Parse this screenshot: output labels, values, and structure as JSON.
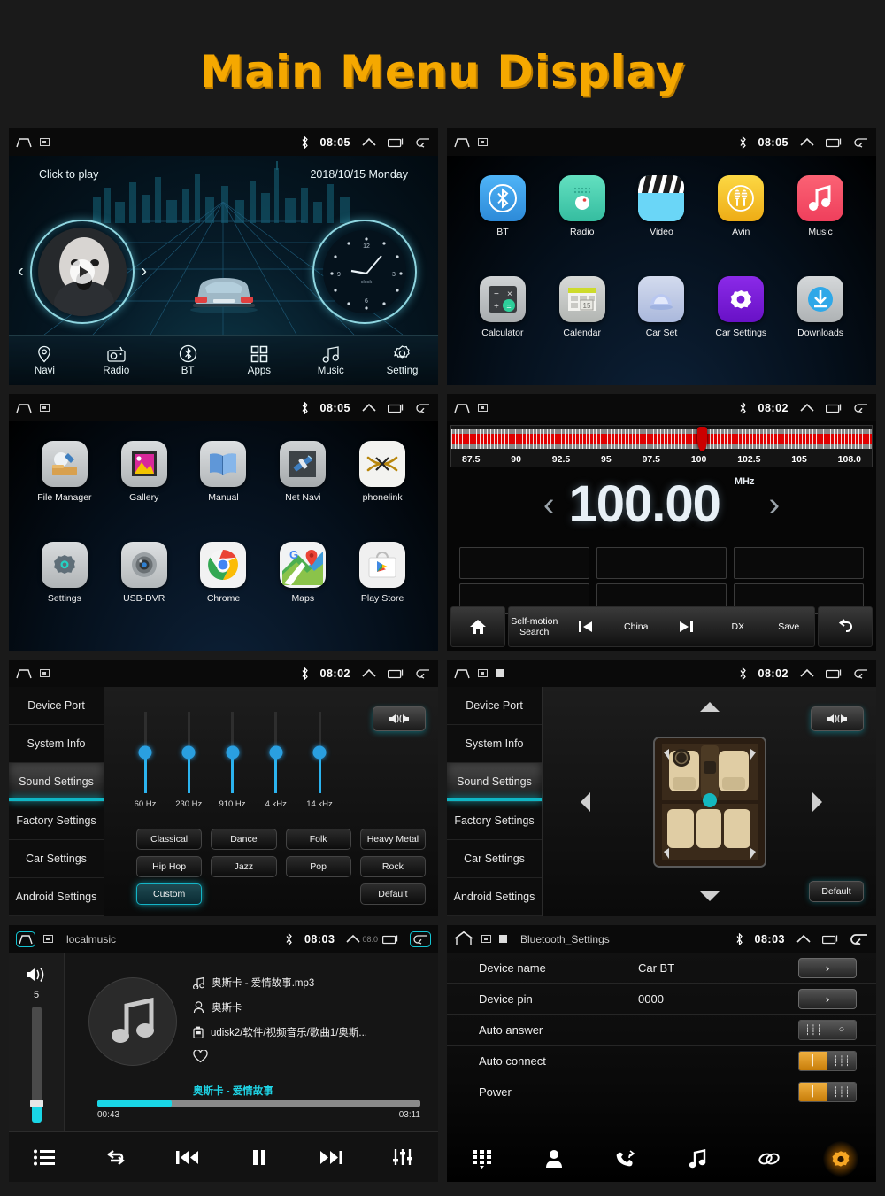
{
  "page": {
    "title": "Main Menu Display",
    "title_color": "#f5a800"
  },
  "panels": {
    "home": {
      "status": {
        "time": "08:05",
        "bt_icon": "bluetooth-icon"
      },
      "click_to_play": "Click to play",
      "date": "2018/10/15  Monday",
      "clock_label": "clock",
      "clock_marks": [
        "12",
        "3",
        "6",
        "9"
      ],
      "dock": [
        {
          "label": "Navi",
          "icon": "location-pin-icon"
        },
        {
          "label": "Radio",
          "icon": "radio-icon"
        },
        {
          "label": "BT",
          "icon": "bluetooth-icon"
        },
        {
          "label": "Apps",
          "icon": "grid-apps-icon"
        },
        {
          "label": "Music",
          "icon": "music-note-icon"
        },
        {
          "label": "Setting",
          "icon": "gear-icon"
        }
      ]
    },
    "apps1": {
      "status": {
        "time": "08:05"
      },
      "items": [
        {
          "label": "BT",
          "icon": "bluetooth-icon",
          "color": "#3fa9f5"
        },
        {
          "label": "Radio",
          "icon": "radio-icon",
          "color": "#4ddbb4"
        },
        {
          "label": "Video",
          "icon": "clapperboard-icon",
          "color": "#5fd0f5"
        },
        {
          "label": "Avin",
          "icon": "avin-icon",
          "color": "#f5c518"
        },
        {
          "label": "Music",
          "icon": "music-note-icon",
          "color": "#f2556b"
        },
        {
          "label": "Calculator",
          "icon": "calculator-icon",
          "color": "#b9bcbe"
        },
        {
          "label": "Calendar",
          "icon": "calendar-icon",
          "color": "#c9cbc9"
        },
        {
          "label": "Car Set",
          "icon": "car-set-icon",
          "color": "#c6cfe0"
        },
        {
          "label": "Car Settings",
          "icon": "car-settings-icon",
          "color": "#7a22d8"
        },
        {
          "label": "Downloads",
          "icon": "download-icon",
          "color": "#c9cbcd"
        }
      ]
    },
    "apps2": {
      "status": {
        "time": "08:05"
      },
      "items": [
        {
          "label": "File Manager",
          "icon": "file-manager-icon",
          "color": "#c9cbcd"
        },
        {
          "label": "Gallery",
          "icon": "gallery-icon",
          "color": "#c9cbcd"
        },
        {
          "label": "Manual",
          "icon": "manual-book-icon",
          "color": "#c9cbcd"
        },
        {
          "label": "Net Navi",
          "icon": "satellite-icon",
          "color": "#b6b9bb"
        },
        {
          "label": "phonelink",
          "icon": "phonelink-icon",
          "color": "#eeeeee"
        },
        {
          "label": "Settings",
          "icon": "gear-icon",
          "color": "#c9cbcd"
        },
        {
          "label": "USB-DVR",
          "icon": "dvr-camera-icon",
          "color": "#c9cbcd"
        },
        {
          "label": "Chrome",
          "icon": "chrome-icon",
          "color": "#f2f2f2"
        },
        {
          "label": "Maps",
          "icon": "maps-icon",
          "color": "#f2f2f2"
        },
        {
          "label": "Play Store",
          "icon": "play-store-icon",
          "color": "#f2f2f2"
        }
      ]
    },
    "radio": {
      "status": {
        "time": "08:02"
      },
      "frequency": "100.00",
      "unit": "MHz",
      "scale_ticks": [
        "87.5",
        "90",
        "92.5",
        "95",
        "97.5",
        "100",
        "102.5",
        "105",
        "108.0"
      ],
      "marker_percent": 59,
      "preset_count": 6,
      "bar": {
        "home": "home-icon",
        "search": "Self-motion\nSearch",
        "prev": "prev-icon",
        "region": "China",
        "next": "next-icon",
        "dx": "DX",
        "save": "Save",
        "back": "back-icon"
      }
    },
    "sound_eq": {
      "status": {
        "time": "08:02"
      },
      "nav": [
        "Device Port",
        "System Info",
        "Sound Settings",
        "Factory Settings",
        "Car Settings",
        "Android Settings"
      ],
      "nav_active": "Sound Settings",
      "bands": [
        {
          "label": "60 Hz",
          "value": 50
        },
        {
          "label": "230 Hz",
          "value": 50
        },
        {
          "label": "910 Hz",
          "value": 50
        },
        {
          "label": "4 kHz",
          "value": 50
        },
        {
          "label": "14 kHz",
          "value": 50
        }
      ],
      "presets": [
        "Classical",
        "Dance",
        "Folk",
        "Heavy Metal",
        "Hip Hop",
        "Jazz",
        "Pop",
        "Rock",
        "Custom",
        "Default"
      ],
      "preset_active": "Custom",
      "default_label": "Default"
    },
    "sound_balance": {
      "status": {
        "time": "08:02"
      },
      "nav": [
        "Device Port",
        "System Info",
        "Sound Settings",
        "Factory Settings",
        "Car Settings",
        "Android Settings"
      ],
      "nav_active": "Sound Settings",
      "default_label": "Default",
      "arrows": [
        "up-arrow-icon",
        "down-arrow-icon",
        "left-arrow-icon",
        "right-arrow-icon"
      ]
    },
    "music": {
      "status": {
        "time": "08:03",
        "title": "localmusic",
        "overlap_time": "08:0"
      },
      "volume": "5",
      "volume_percent": 13,
      "track_file": "奥斯卡 - 爱情故事.mp3",
      "artist": "奥斯卡",
      "path": "udisk2/软件/视频音乐/歌曲1/奥斯...",
      "favorite_icon": "heart-icon",
      "now_playing": "奥斯卡 - 爱情故事",
      "time_current": "00:43",
      "time_total": "03:11",
      "progress_percent": 23,
      "controls": [
        "playlist-icon",
        "repeat-icon",
        "previous-icon",
        "pause-icon",
        "next-icon",
        "equalizer-icon"
      ]
    },
    "bluetooth": {
      "status": {
        "time": "08:03",
        "title": "Bluetooth_Settings"
      },
      "rows": [
        {
          "label": "Device name",
          "value": "Car BT",
          "control": "arrow"
        },
        {
          "label": "Device pin",
          "value": "0000",
          "control": "arrow"
        },
        {
          "label": "Auto answer",
          "value": "",
          "control": "toggle",
          "state": "off"
        },
        {
          "label": "Auto connect",
          "value": "",
          "control": "toggle",
          "state": "on"
        },
        {
          "label": "Power",
          "value": "",
          "control": "toggle",
          "state": "on"
        }
      ],
      "tabs": [
        "dialpad-icon",
        "contacts-icon",
        "call-history-icon",
        "bt-music-icon",
        "pair-link-icon",
        "settings-gear-icon"
      ],
      "tab_active": "settings-gear-icon",
      "accent": "#e09a20"
    }
  }
}
